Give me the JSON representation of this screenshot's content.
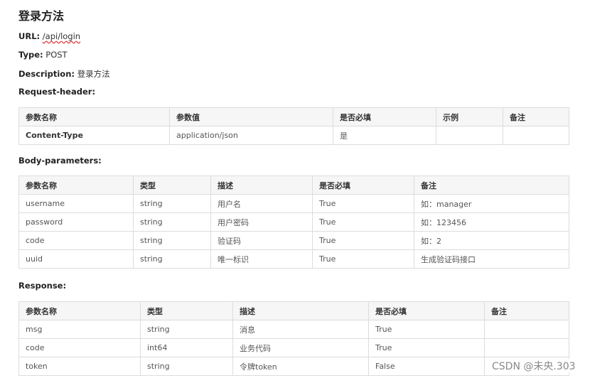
{
  "title": "登录方法",
  "url": {
    "label": "URL:",
    "value": "/api/login"
  },
  "type": {
    "label": "Type:",
    "value": "POST"
  },
  "description": {
    "label": "Description:",
    "value": "登录方法"
  },
  "request_header": {
    "label": "Request-header:",
    "columns": [
      "参数名称",
      "参数值",
      "是否必填",
      "示例",
      "备注"
    ],
    "rows": [
      [
        "Content-Type",
        "application/json",
        "是",
        "",
        ""
      ]
    ]
  },
  "body_parameters": {
    "label": "Body-parameters:",
    "columns": [
      "参数名称",
      "类型",
      "描述",
      "是否必填",
      "备注"
    ],
    "rows": [
      [
        "username",
        "string",
        "用户名",
        "True",
        "如：manager"
      ],
      [
        "password",
        "string",
        "用户密码",
        "True",
        "如：123456"
      ],
      [
        "code",
        "string",
        "验证码",
        "True",
        "如：2"
      ],
      [
        "uuid",
        "string",
        "唯一标识",
        "True",
        "生成验证码接口"
      ]
    ]
  },
  "response": {
    "label": "Response:",
    "columns": [
      "参数名称",
      "类型",
      "描述",
      "是否必填",
      "备注"
    ],
    "rows": [
      [
        "msg",
        "string",
        "消息",
        "True",
        ""
      ],
      [
        "code",
        "int64",
        "业务代码",
        "True",
        ""
      ],
      [
        "token",
        "string",
        "令牌token",
        "False",
        ""
      ]
    ]
  },
  "watermark": "CSDN @未央.303"
}
